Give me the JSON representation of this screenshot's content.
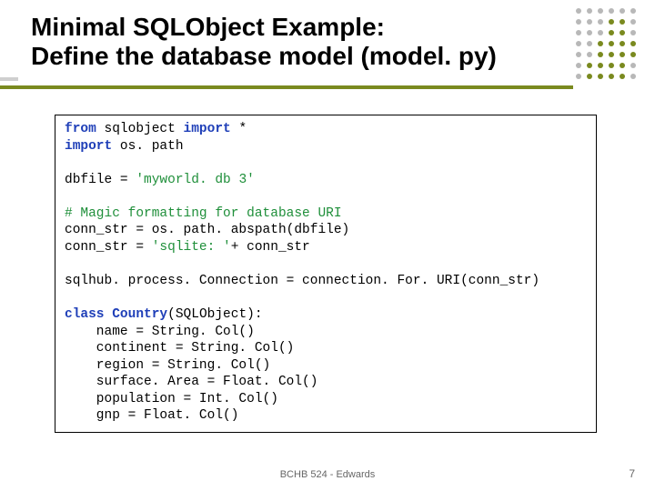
{
  "title_line1": "Minimal SQLObject Example:",
  "title_line2": "Define the database model (model. py)",
  "code": {
    "l1a": "from",
    "l1b": " sqlobject ",
    "l1c": "import",
    "l1d": " *",
    "l2a": "import",
    "l2b": " os. path",
    "l3": "",
    "l4a": "dbfile = ",
    "l4b": "'myworld. db 3'",
    "l5": "",
    "l6a": "# Magic formatting for database URI",
    "l7a": "conn_str = os. path. abspath(dbfile)",
    "l8a": "conn_str = ",
    "l8b": "'sqlite: '",
    "l8c": "+ conn_str",
    "l9": "",
    "l10": "sqlhub. process. Connection = connection. For. URI(conn_str)",
    "l11": "",
    "l12a": "class",
    "l12b": " ",
    "l12c": "Country",
    "l12d": "(SQLObject):",
    "l13": "    name = String. Col()",
    "l14": "    continent = String. Col()",
    "l15": "    region = String. Col()",
    "l16": "    surface. Area = Float. Col()",
    "l17": "    population = Int. Col()",
    "l18": "    gnp = Float. Col()"
  },
  "footer": "BCHB 524 - Edwards",
  "page": "7",
  "colors": {
    "olive": "#7a8a1f",
    "gray": "#b8b8b8"
  }
}
